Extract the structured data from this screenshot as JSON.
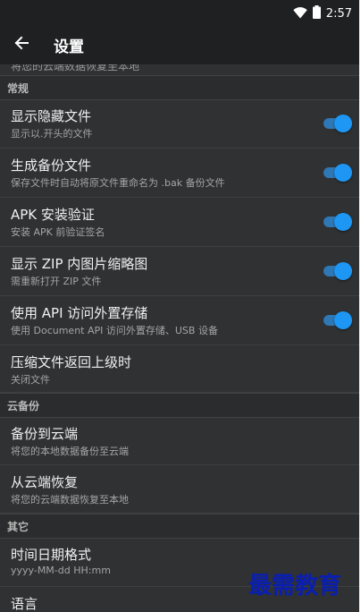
{
  "status": {
    "time": "2:57"
  },
  "appbar": {
    "title": "设置"
  },
  "partial_row": {
    "text": "将您的云端数据恢复至本地"
  },
  "sections": {
    "general": "常规",
    "cloud": "云备份",
    "other": "其它"
  },
  "rows": {
    "show_hidden": {
      "title": "显示隐藏文件",
      "subtitle": "显示以.开头的文件",
      "toggle_on": true
    },
    "backup": {
      "title": "生成备份文件",
      "subtitle": "保存文件时自动将原文件重命名为 .bak 备份文件",
      "toggle_on": true
    },
    "apk_verify": {
      "title": "APK 安装验证",
      "subtitle": "安装 APK 前验证签名",
      "toggle_on": true
    },
    "zip_thumb": {
      "title": "显示 ZIP 内图片缩略图",
      "subtitle": "需重新打开 ZIP 文件",
      "toggle_on": true
    },
    "api_storage": {
      "title": "使用 API 访问外置存储",
      "subtitle": "使用 Document API 访问外置存储、USB 设备",
      "toggle_on": true
    },
    "zip_back": {
      "title": "压缩文件返回上级时",
      "subtitle": "关闭文件"
    },
    "cloud_backup": {
      "title": "备份到云端",
      "subtitle": "将您的本地数据备份至云端"
    },
    "cloud_restore": {
      "title": "从云端恢复",
      "subtitle": "将您的云端数据恢复至本地"
    },
    "date_format": {
      "title": "时间日期格式",
      "subtitle": "yyyy-MM-dd HH:mm"
    },
    "language": {
      "title": "语言"
    }
  },
  "colors": {
    "background": "#2f3132",
    "toolbar": "#1f2021",
    "accent": "#1e96f3"
  },
  "icons": [
    "wifi-icon",
    "battery-icon",
    "back-arrow-icon"
  ],
  "watermark": "最需教育"
}
